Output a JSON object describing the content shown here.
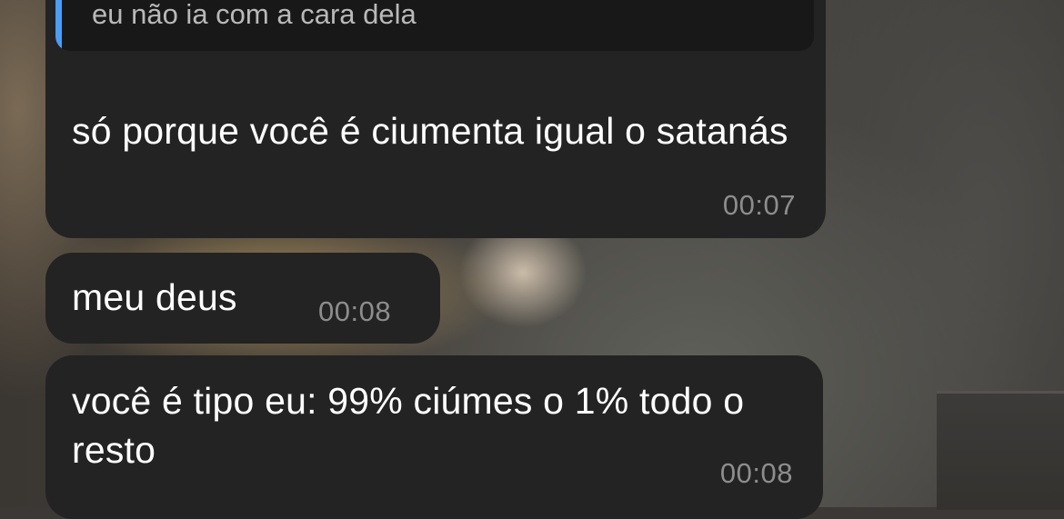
{
  "messages": [
    {
      "reply_to": "eu não ia com a cara dela",
      "text": "só porque você é ciumenta igual o satanás",
      "time": "00:07"
    },
    {
      "text": "meu deus",
      "time": "00:08"
    },
    {
      "text": "você é tipo eu: 99% ciúmes o 1% todo o resto",
      "time": "00:08"
    }
  ],
  "colors": {
    "bubble": "#232323",
    "reply_background": "#181818",
    "reply_accent": "#4b9cf5",
    "text": "#ffffff",
    "timestamp": "#8d8d8d"
  }
}
